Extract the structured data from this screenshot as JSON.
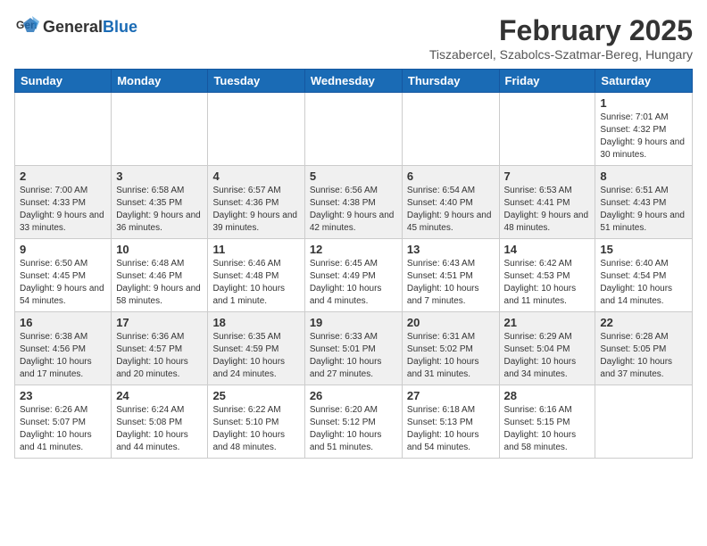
{
  "header": {
    "logo_general": "General",
    "logo_blue": "Blue",
    "month_title": "February 2025",
    "location": "Tiszabercel, Szabolcs-Szatmar-Bereg, Hungary"
  },
  "weekdays": [
    "Sunday",
    "Monday",
    "Tuesday",
    "Wednesday",
    "Thursday",
    "Friday",
    "Saturday"
  ],
  "weeks": [
    [
      {
        "day": "",
        "info": ""
      },
      {
        "day": "",
        "info": ""
      },
      {
        "day": "",
        "info": ""
      },
      {
        "day": "",
        "info": ""
      },
      {
        "day": "",
        "info": ""
      },
      {
        "day": "",
        "info": ""
      },
      {
        "day": "1",
        "info": "Sunrise: 7:01 AM\nSunset: 4:32 PM\nDaylight: 9 hours and 30 minutes."
      }
    ],
    [
      {
        "day": "2",
        "info": "Sunrise: 7:00 AM\nSunset: 4:33 PM\nDaylight: 9 hours and 33 minutes."
      },
      {
        "day": "3",
        "info": "Sunrise: 6:58 AM\nSunset: 4:35 PM\nDaylight: 9 hours and 36 minutes."
      },
      {
        "day": "4",
        "info": "Sunrise: 6:57 AM\nSunset: 4:36 PM\nDaylight: 9 hours and 39 minutes."
      },
      {
        "day": "5",
        "info": "Sunrise: 6:56 AM\nSunset: 4:38 PM\nDaylight: 9 hours and 42 minutes."
      },
      {
        "day": "6",
        "info": "Sunrise: 6:54 AM\nSunset: 4:40 PM\nDaylight: 9 hours and 45 minutes."
      },
      {
        "day": "7",
        "info": "Sunrise: 6:53 AM\nSunset: 4:41 PM\nDaylight: 9 hours and 48 minutes."
      },
      {
        "day": "8",
        "info": "Sunrise: 6:51 AM\nSunset: 4:43 PM\nDaylight: 9 hours and 51 minutes."
      }
    ],
    [
      {
        "day": "9",
        "info": "Sunrise: 6:50 AM\nSunset: 4:45 PM\nDaylight: 9 hours and 54 minutes."
      },
      {
        "day": "10",
        "info": "Sunrise: 6:48 AM\nSunset: 4:46 PM\nDaylight: 9 hours and 58 minutes."
      },
      {
        "day": "11",
        "info": "Sunrise: 6:46 AM\nSunset: 4:48 PM\nDaylight: 10 hours and 1 minute."
      },
      {
        "day": "12",
        "info": "Sunrise: 6:45 AM\nSunset: 4:49 PM\nDaylight: 10 hours and 4 minutes."
      },
      {
        "day": "13",
        "info": "Sunrise: 6:43 AM\nSunset: 4:51 PM\nDaylight: 10 hours and 7 minutes."
      },
      {
        "day": "14",
        "info": "Sunrise: 6:42 AM\nSunset: 4:53 PM\nDaylight: 10 hours and 11 minutes."
      },
      {
        "day": "15",
        "info": "Sunrise: 6:40 AM\nSunset: 4:54 PM\nDaylight: 10 hours and 14 minutes."
      }
    ],
    [
      {
        "day": "16",
        "info": "Sunrise: 6:38 AM\nSunset: 4:56 PM\nDaylight: 10 hours and 17 minutes."
      },
      {
        "day": "17",
        "info": "Sunrise: 6:36 AM\nSunset: 4:57 PM\nDaylight: 10 hours and 20 minutes."
      },
      {
        "day": "18",
        "info": "Sunrise: 6:35 AM\nSunset: 4:59 PM\nDaylight: 10 hours and 24 minutes."
      },
      {
        "day": "19",
        "info": "Sunrise: 6:33 AM\nSunset: 5:01 PM\nDaylight: 10 hours and 27 minutes."
      },
      {
        "day": "20",
        "info": "Sunrise: 6:31 AM\nSunset: 5:02 PM\nDaylight: 10 hours and 31 minutes."
      },
      {
        "day": "21",
        "info": "Sunrise: 6:29 AM\nSunset: 5:04 PM\nDaylight: 10 hours and 34 minutes."
      },
      {
        "day": "22",
        "info": "Sunrise: 6:28 AM\nSunset: 5:05 PM\nDaylight: 10 hours and 37 minutes."
      }
    ],
    [
      {
        "day": "23",
        "info": "Sunrise: 6:26 AM\nSunset: 5:07 PM\nDaylight: 10 hours and 41 minutes."
      },
      {
        "day": "24",
        "info": "Sunrise: 6:24 AM\nSunset: 5:08 PM\nDaylight: 10 hours and 44 minutes."
      },
      {
        "day": "25",
        "info": "Sunrise: 6:22 AM\nSunset: 5:10 PM\nDaylight: 10 hours and 48 minutes."
      },
      {
        "day": "26",
        "info": "Sunrise: 6:20 AM\nSunset: 5:12 PM\nDaylight: 10 hours and 51 minutes."
      },
      {
        "day": "27",
        "info": "Sunrise: 6:18 AM\nSunset: 5:13 PM\nDaylight: 10 hours and 54 minutes."
      },
      {
        "day": "28",
        "info": "Sunrise: 6:16 AM\nSunset: 5:15 PM\nDaylight: 10 hours and 58 minutes."
      },
      {
        "day": "",
        "info": ""
      }
    ]
  ]
}
